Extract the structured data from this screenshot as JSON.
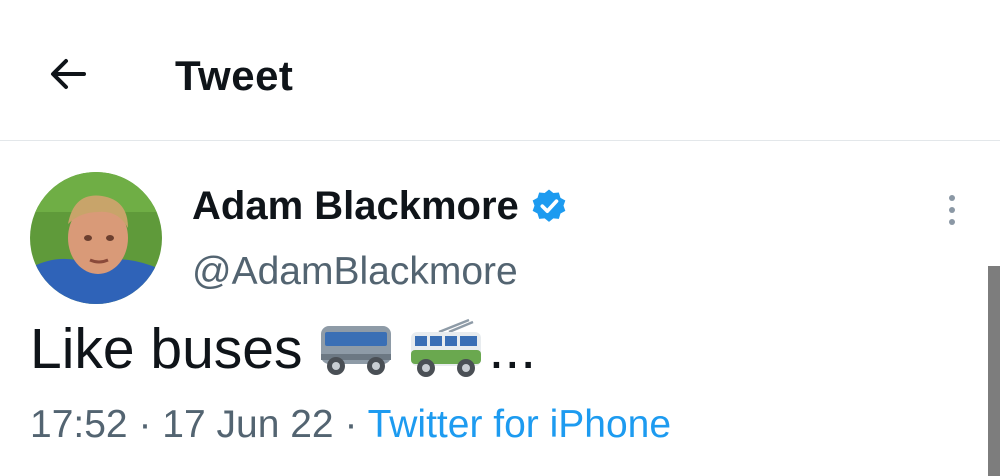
{
  "header": {
    "title": "Tweet",
    "back_icon": "arrow-left-icon"
  },
  "tweet": {
    "author_name": "Adam Blackmore",
    "verified": true,
    "handle": "@AdamBlackmore",
    "text": "Like buses",
    "emojis": [
      "bus-icon",
      "trolleybus-icon"
    ],
    "trailing": "...",
    "time": "17:52",
    "separator": "·",
    "date": "17 Jun 22",
    "source": "Twitter for iPhone"
  },
  "colors": {
    "accent": "#1d9bf0",
    "muted": "#536471",
    "text": "#0f1419"
  }
}
